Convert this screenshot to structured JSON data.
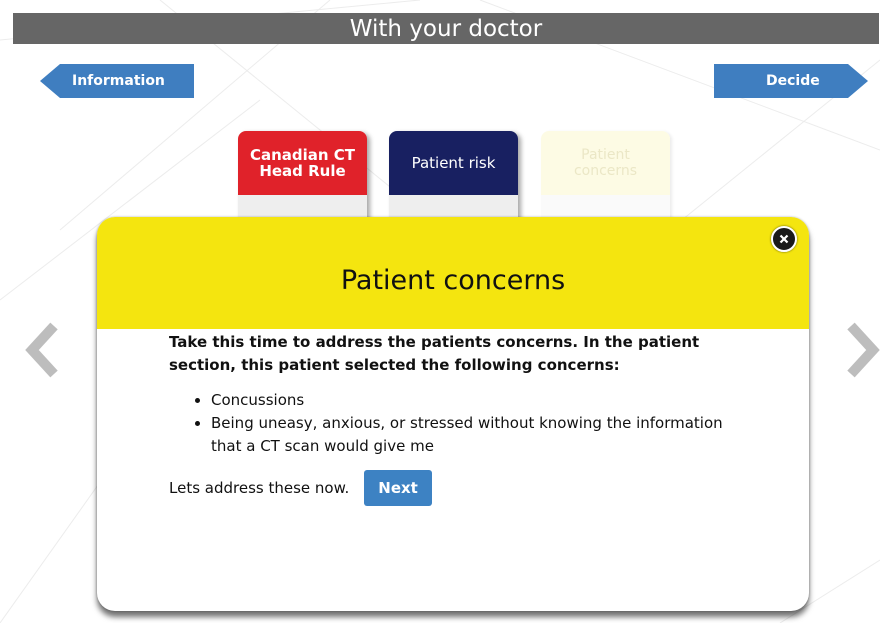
{
  "header": {
    "title": "With your doctor"
  },
  "nav": {
    "back_label": "Information",
    "forward_label": "Decide"
  },
  "cards": [
    {
      "label": "Canadian CT Head Rule",
      "color": "#e0222a"
    },
    {
      "label": "Patient risk",
      "color": "#182061"
    },
    {
      "label": "Patient concerns",
      "color": "#fdfbe4"
    }
  ],
  "modal": {
    "title": "Patient concerns",
    "intro": "Take this time to address the patients concerns. In the patient section, this patient selected the following concerns:",
    "concerns": [
      "Concussions",
      "Being uneasy, anxious, or stressed without knowing the information that a CT scan would give me"
    ],
    "prompt": "Lets address these now.",
    "next_label": "Next",
    "header_color": "#f4e50f",
    "close_icon": "close-icon"
  },
  "icons": {
    "prev": "chevron-left-icon",
    "next": "chevron-right-icon"
  }
}
